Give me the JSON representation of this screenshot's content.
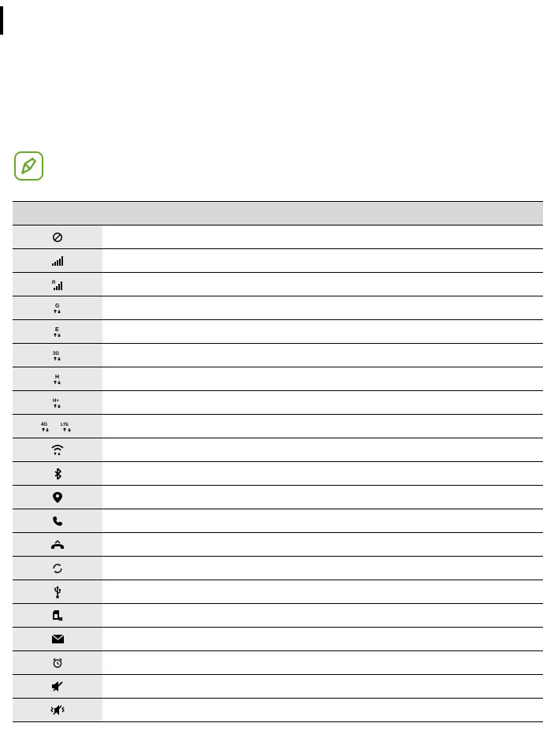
{
  "header": {
    "icon_label": "",
    "meaning_label": ""
  },
  "rows": [
    {
      "icon": "no-signal",
      "desc": ""
    },
    {
      "icon": "signal-strength",
      "desc": ""
    },
    {
      "icon": "roaming",
      "desc": ""
    },
    {
      "icon": "gprs",
      "desc": ""
    },
    {
      "icon": "edge",
      "desc": ""
    },
    {
      "icon": "3g",
      "desc": ""
    },
    {
      "icon": "hsdpa",
      "desc": ""
    },
    {
      "icon": "hsdpa-plus",
      "desc": ""
    },
    {
      "icon": "4g-lte",
      "desc": ""
    },
    {
      "icon": "wifi",
      "desc": ""
    },
    {
      "icon": "bluetooth",
      "desc": ""
    },
    {
      "icon": "location",
      "desc": ""
    },
    {
      "icon": "call",
      "desc": ""
    },
    {
      "icon": "missed-call",
      "desc": ""
    },
    {
      "icon": "sync",
      "desc": ""
    },
    {
      "icon": "usb",
      "desc": ""
    },
    {
      "icon": "no-sim",
      "desc": ""
    },
    {
      "icon": "message",
      "desc": ""
    },
    {
      "icon": "alarm",
      "desc": ""
    },
    {
      "icon": "mute",
      "desc": ""
    },
    {
      "icon": "vibrate",
      "desc": ""
    }
  ]
}
